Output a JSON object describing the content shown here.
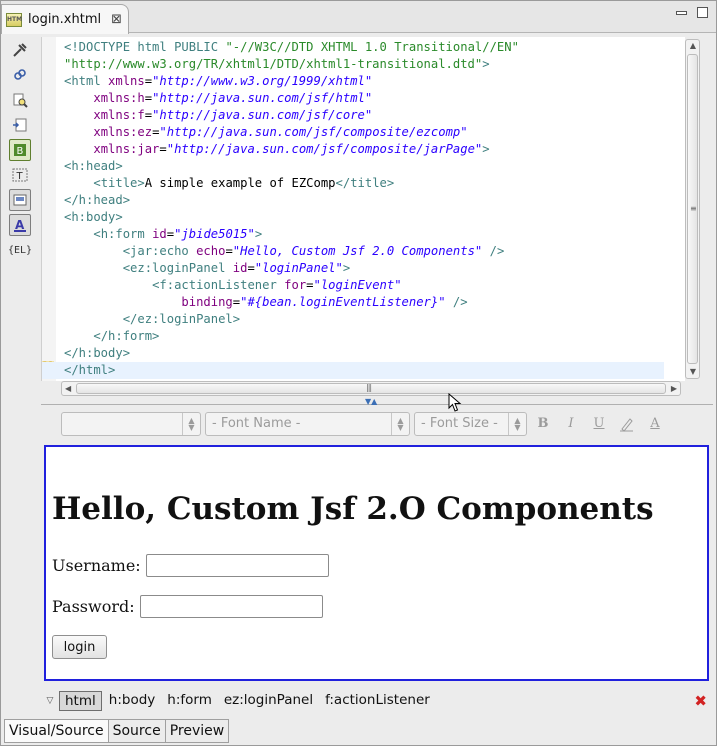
{
  "tab": {
    "icon": "xhtml-file-icon",
    "filename": "login.xhtml",
    "close_glyph": "⊠"
  },
  "toolbar_icons": [
    "tools-icon",
    "links-icon",
    "find-icon",
    "page-icon",
    "bundle-icon",
    "text-icon",
    "panel-icon",
    "font-icon",
    "el-icon"
  ],
  "el_label": "{EL}",
  "code_lines": [
    [
      {
        "c": "t-doc",
        "t": "<!DOCTYPE html "
      },
      {
        "c": "t-doc",
        "t": "PUBLIC "
      },
      {
        "c": "t-str",
        "t": "\"-//W3C//DTD XHTML 1.0 Transitional//EN\""
      }
    ],
    [
      {
        "c": "t-str",
        "t": "\"http://www.w3.org/TR/xhtml1/DTD/xhtml1-transitional.dtd\""
      },
      {
        "c": "t-doc",
        "t": ">"
      }
    ],
    [
      {
        "c": "t-tag",
        "t": "<html "
      },
      {
        "c": "t-attr",
        "t": "xmlns"
      },
      {
        "c": "t-txt",
        "t": "="
      },
      {
        "c": "t-val",
        "t": "\"http://www.w3.org/1999/xhtml\""
      }
    ],
    [
      {
        "c": "t-txt",
        "t": "    "
      },
      {
        "c": "t-attr",
        "t": "xmlns:h"
      },
      {
        "c": "t-txt",
        "t": "="
      },
      {
        "c": "t-val",
        "t": "\"http://java.sun.com/jsf/html\""
      }
    ],
    [
      {
        "c": "t-txt",
        "t": "    "
      },
      {
        "c": "t-attr",
        "t": "xmlns:f"
      },
      {
        "c": "t-txt",
        "t": "="
      },
      {
        "c": "t-val",
        "t": "\"http://java.sun.com/jsf/core\""
      }
    ],
    [
      {
        "c": "t-txt",
        "t": "    "
      },
      {
        "c": "t-attr",
        "t": "xmlns:ez"
      },
      {
        "c": "t-txt",
        "t": "="
      },
      {
        "c": "t-val",
        "t": "\"http://java.sun.com/jsf/composite/ezcomp\""
      }
    ],
    [
      {
        "c": "t-txt",
        "t": "    "
      },
      {
        "c": "t-attr",
        "t": "xmlns:jar"
      },
      {
        "c": "t-txt",
        "t": "="
      },
      {
        "c": "t-val",
        "t": "\"http://java.sun.com/jsf/composite/jarPage\""
      },
      {
        "c": "t-tag",
        "t": ">"
      }
    ],
    [
      {
        "c": "t-tag",
        "t": "<h:head>"
      }
    ],
    [
      {
        "c": "t-txt",
        "t": "    "
      },
      {
        "c": "t-tag",
        "t": "<title>"
      },
      {
        "c": "t-txt",
        "t": "A simple example of EZComp"
      },
      {
        "c": "t-tag",
        "t": "</title>"
      }
    ],
    [
      {
        "c": "t-tag",
        "t": "</h:head>"
      }
    ],
    [
      {
        "c": "t-tag",
        "t": "<h:body>"
      }
    ],
    [
      {
        "c": "t-txt",
        "t": "    "
      },
      {
        "c": "t-tag",
        "t": "<h:form "
      },
      {
        "c": "t-attr",
        "t": "id"
      },
      {
        "c": "t-txt",
        "t": "="
      },
      {
        "c": "t-val",
        "t": "\"jbide5015\""
      },
      {
        "c": "t-tag",
        "t": ">"
      }
    ],
    [
      {
        "c": "t-txt",
        "t": "        "
      },
      {
        "c": "t-tag",
        "t": "<jar:echo "
      },
      {
        "c": "t-attr",
        "t": "echo"
      },
      {
        "c": "t-txt",
        "t": "="
      },
      {
        "c": "t-val",
        "t": "\"Hello, Custom Jsf 2.0 Components\""
      },
      {
        "c": "t-tag",
        "t": " />"
      }
    ],
    [
      {
        "c": "t-txt",
        "t": "        "
      },
      {
        "c": "t-tag",
        "t": "<ez:loginPanel "
      },
      {
        "c": "t-attr",
        "t": "id"
      },
      {
        "c": "t-txt",
        "t": "="
      },
      {
        "c": "t-val",
        "t": "\"loginPanel\""
      },
      {
        "c": "t-tag",
        "t": ">"
      }
    ],
    [
      {
        "c": "t-txt",
        "t": "            "
      },
      {
        "c": "t-tag",
        "t": "<f:actionListener "
      },
      {
        "c": "t-attr",
        "t": "for"
      },
      {
        "c": "t-txt",
        "t": "="
      },
      {
        "c": "t-val",
        "t": "\"loginEvent\""
      }
    ],
    [
      {
        "c": "t-txt",
        "t": "                "
      },
      {
        "c": "t-attr",
        "t": "binding"
      },
      {
        "c": "t-txt",
        "t": "="
      },
      {
        "c": "t-val",
        "t": "\"#{bean.loginEventListener}\""
      },
      {
        "c": "t-tag",
        "t": " />"
      }
    ],
    [
      {
        "c": "t-txt",
        "t": "        "
      },
      {
        "c": "t-tag",
        "t": "</ez:loginPanel>"
      }
    ],
    [
      {
        "c": "t-txt",
        "t": "    "
      },
      {
        "c": "t-tag",
        "t": "</h:form>"
      }
    ],
    [
      {
        "c": "t-tag",
        "t": "</h:body>"
      }
    ],
    [
      {
        "c": "t-tag",
        "t": "</html>"
      }
    ]
  ],
  "current_line": 19,
  "format_toolbar": {
    "style_combo": "",
    "font_name": "- Font Name -",
    "font_size": "- Font Size -",
    "bold": "B",
    "italic": "I",
    "underline": "U",
    "highlight_icon": "highlight-pen-icon",
    "font_color": "A"
  },
  "visual": {
    "heading": "Hello, Custom Jsf 2.O Components",
    "username_label": "Username:",
    "password_label": "Password:",
    "login_button": "login"
  },
  "breadcrumbs": [
    "html",
    "h:body",
    "h:form",
    "ez:loginPanel",
    "f:actionListener"
  ],
  "active_crumb": 0,
  "bottom_tabs": [
    "Visual/Source",
    "Source",
    "Preview"
  ],
  "colors": {
    "visual_border": "#2020dd",
    "close_x": "#d22222"
  }
}
